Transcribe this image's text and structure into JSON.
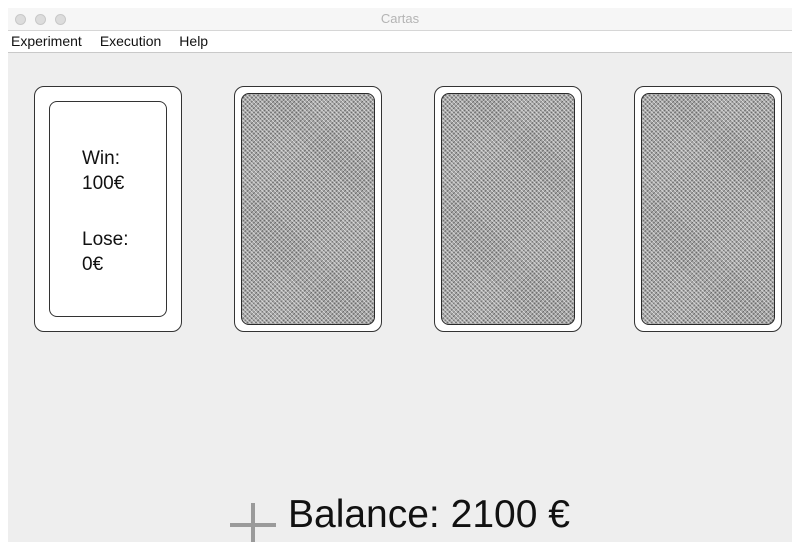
{
  "window": {
    "title": "Cartas"
  },
  "menubar": {
    "items": [
      "Experiment",
      "Execution",
      "Help"
    ]
  },
  "cards": {
    "revealed": {
      "win_label": "Win:",
      "win_value": "100€",
      "lose_label": "Lose:",
      "lose_value": "0€"
    },
    "face_down_count": 3
  },
  "footer": {
    "balance_label": "Balance:",
    "balance_value": "2100 €",
    "icon": "plus-icon"
  }
}
